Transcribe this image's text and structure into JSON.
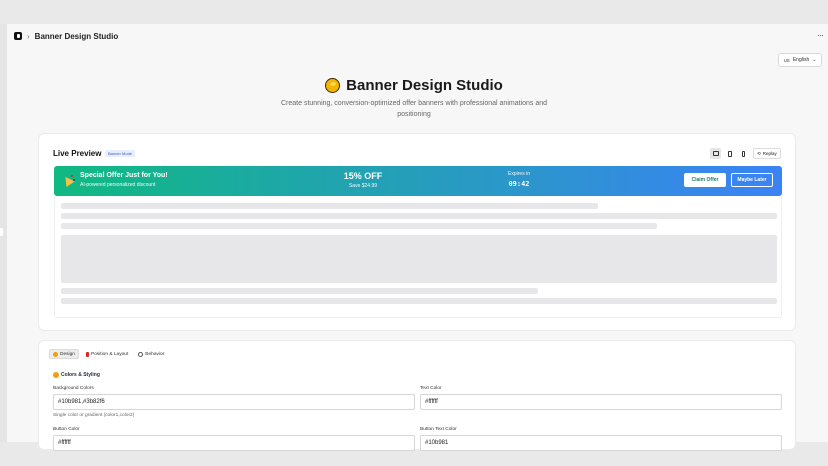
{
  "window": {
    "breadcrumb_sep": "›",
    "title": "Banner Design Studio",
    "more_label": "···"
  },
  "language": {
    "flag": "US",
    "label": "English",
    "chevron": "⌄"
  },
  "hero": {
    "title": "Banner Design Studio",
    "subtitle": "Create stunning, conversion-optimized offer banners with professional animations and positioning"
  },
  "preview": {
    "title": "Live Preview",
    "badge": "Banner Mode",
    "replay_label": "Replay",
    "replay_icon": "⟲",
    "banner": {
      "title": "Special Offer Just for You!",
      "subtitle": "AI-powered personalized discount",
      "percent": "15% OFF",
      "save": "Save $24.99",
      "expires_label": "Expires in",
      "timer": "09:42",
      "claim_label": "Claim Offer",
      "later_label": "Maybe Later",
      "gradient_start": "#10b981",
      "gradient_end": "#3b82f6"
    }
  },
  "tabs": [
    {
      "label": "Design",
      "active": true
    },
    {
      "label": "Position & Layout",
      "active": false
    },
    {
      "label": "Behavior",
      "active": false
    }
  ],
  "styling": {
    "section_title": "Colors & Styling",
    "bg_label": "Background Colors",
    "bg_value": "#10b981,#3b82f6",
    "bg_hint": "Single color or gradient (color1,color2)",
    "text_label": "Text Color",
    "text_value": "#ffffff",
    "button_label": "Button Color",
    "button_value": "#ffffff",
    "button_text_label": "Button Text Color",
    "button_text_value": "#10b981"
  }
}
